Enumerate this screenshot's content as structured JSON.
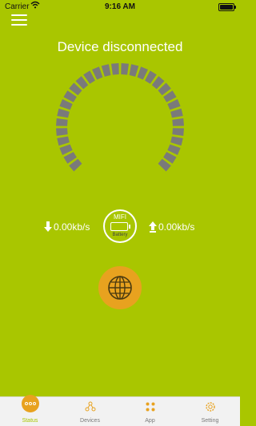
{
  "status_bar": {
    "carrier": "Carrier",
    "time": "9:16 AM"
  },
  "header": {
    "title": "Device disconnected"
  },
  "signal_gauge": {
    "segments_total": 30,
    "segments_lit": 0,
    "segment_color": "#7a7a7a"
  },
  "speeds": {
    "download": "0.00kb/s",
    "upload": "0.00kb/s"
  },
  "battery_badge": {
    "device": "MIFI",
    "label": "Battery"
  },
  "tabs": [
    {
      "label": "Status",
      "icon": "status-icon",
      "active": true
    },
    {
      "label": "Devices",
      "icon": "devices-icon",
      "active": false
    },
    {
      "label": "App",
      "icon": "app-icon",
      "active": false
    },
    {
      "label": "Setting",
      "icon": "gear-icon",
      "active": false
    }
  ],
  "colors": {
    "background": "#a9c600",
    "accent": "#e8a21f",
    "gauge_segment": "#7a7a7a"
  }
}
